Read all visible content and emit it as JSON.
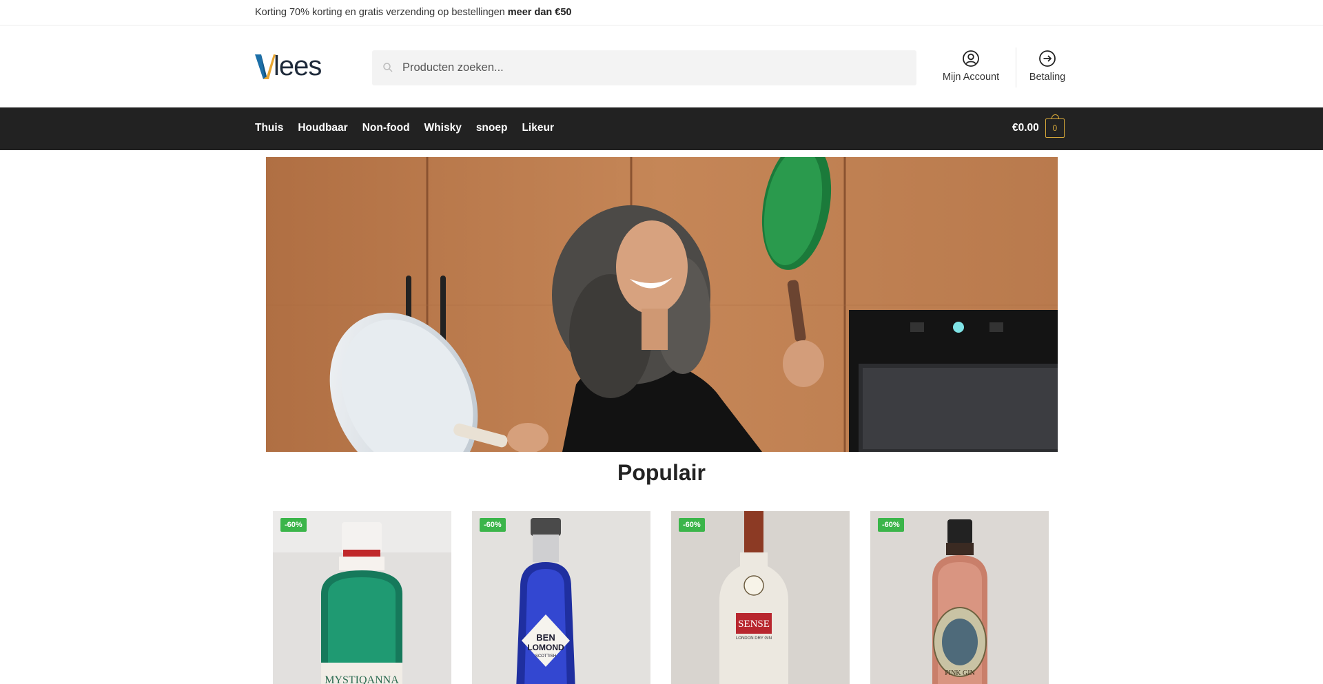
{
  "promo": {
    "text": "Korting 70% korting en gratis verzending op bestellingen ",
    "highlight": "meer dan €50"
  },
  "header": {
    "logo_text": "lees",
    "search_placeholder": "Producten zoeken...",
    "account_label": "Mijn Account",
    "checkout_label": "Betaling"
  },
  "nav": {
    "items": [
      {
        "label": "Thuis"
      },
      {
        "label": "Houdbaar"
      },
      {
        "label": "Non-food"
      },
      {
        "label": "Whisky"
      },
      {
        "label": "snoep"
      },
      {
        "label": "Likeur"
      }
    ],
    "cart_total": "€0.00",
    "cart_count": "0"
  },
  "section": {
    "title": "Populair"
  },
  "products": [
    {
      "badge": "-60%",
      "label": "MYSTIQANNA"
    },
    {
      "badge": "-60%",
      "label_lines": [
        "BEN",
        "LOMOND",
        "SCOTTISH",
        "GIN"
      ]
    },
    {
      "badge": "-60%",
      "label_lines": [
        "SENSE",
        "LONDON DRY GIN"
      ]
    },
    {
      "badge": "-60%",
      "label": "PINK GIN"
    }
  ],
  "colors": {
    "accent": "#d8a93a",
    "nav_bg": "#222222",
    "badge": "#3bb54a"
  }
}
